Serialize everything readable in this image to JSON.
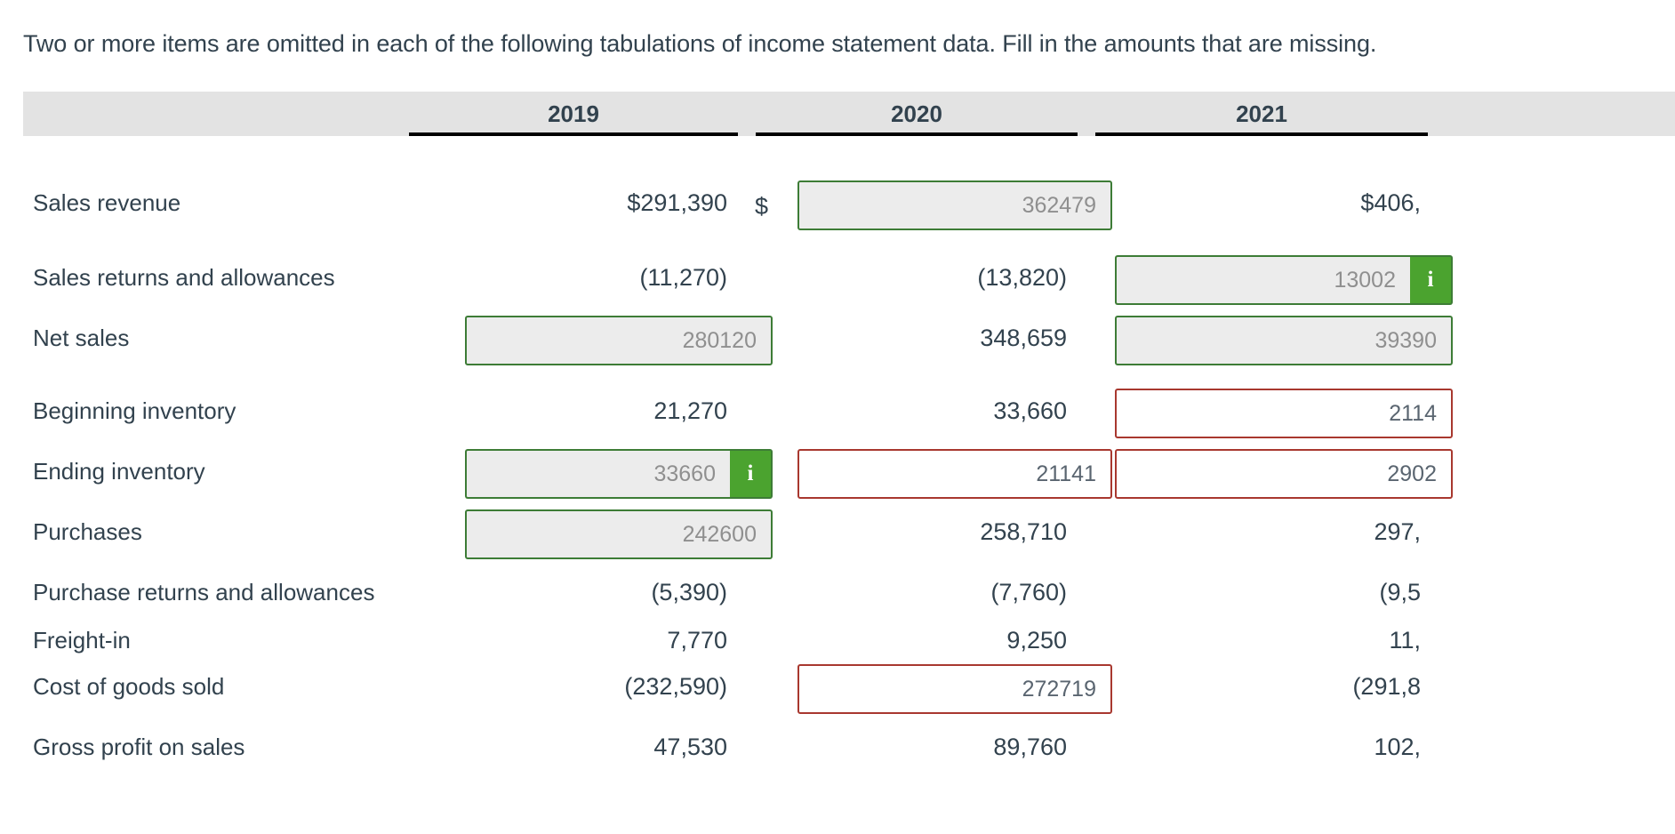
{
  "prompt": "Two or more items are omitted in each of the following tabulations of income statement data. Fill in the amounts that are missing.",
  "columns": [
    {
      "year": "2019"
    },
    {
      "year": "2020"
    },
    {
      "year": "2021"
    }
  ],
  "currency_symbol": "$",
  "info_badge_glyph": "i",
  "colors": {
    "header_bg": "#e3e3e3",
    "text": "#32424e",
    "input_correct_border": "#3d7c36",
    "input_correct_bg": "#ececec",
    "input_incorrect_border": "#a8382f",
    "badge_bg": "#4ba32f",
    "placeholder_text": "#8f8f8f"
  },
  "rows": [
    {
      "label": "Sales revenue",
      "cells": [
        {
          "type": "text",
          "value": "$291,390"
        },
        {
          "type": "input",
          "state": "correct",
          "value": "362479",
          "prefix": "$",
          "badge": false
        },
        {
          "type": "text",
          "value": "$406,"
        }
      ]
    },
    {
      "label": "Sales returns and allowances",
      "cells": [
        {
          "type": "text",
          "value": "(11,270)"
        },
        {
          "type": "text",
          "value": "(13,820)"
        },
        {
          "type": "input",
          "state": "correct",
          "value": "13002",
          "badge": true
        }
      ]
    },
    {
      "label": "Net sales",
      "cells": [
        {
          "type": "input",
          "state": "correct",
          "value": "280120",
          "badge": false
        },
        {
          "type": "text",
          "value": "348,659"
        },
        {
          "type": "input",
          "state": "correct",
          "value": "39390",
          "badge": false
        }
      ]
    },
    {
      "label": "Beginning inventory",
      "cells": [
        {
          "type": "text",
          "value": "21,270"
        },
        {
          "type": "text",
          "value": "33,660"
        },
        {
          "type": "input",
          "state": "incorrect",
          "value": "2114",
          "badge": false
        }
      ]
    },
    {
      "label": "Ending inventory",
      "cells": [
        {
          "type": "input",
          "state": "correct",
          "value": "33660",
          "badge": true
        },
        {
          "type": "input",
          "state": "incorrect",
          "value": "21141",
          "badge": false
        },
        {
          "type": "input",
          "state": "incorrect",
          "value": "2902",
          "badge": false
        }
      ]
    },
    {
      "label": "Purchases",
      "cells": [
        {
          "type": "input",
          "state": "correct",
          "value": "242600",
          "badge": false
        },
        {
          "type": "text",
          "value": "258,710"
        },
        {
          "type": "text",
          "value": "297,"
        }
      ]
    },
    {
      "label": "Purchase returns and allowances",
      "cells": [
        {
          "type": "text",
          "value": "(5,390)"
        },
        {
          "type": "text",
          "value": "(7,760)"
        },
        {
          "type": "text",
          "value": "(9,5"
        }
      ]
    },
    {
      "label": "Freight-in",
      "cells": [
        {
          "type": "text",
          "value": "7,770"
        },
        {
          "type": "text",
          "value": "9,250"
        },
        {
          "type": "text",
          "value": "11,"
        }
      ]
    },
    {
      "label": "Cost of goods sold",
      "cells": [
        {
          "type": "text",
          "value": "(232,590)"
        },
        {
          "type": "input",
          "state": "incorrect",
          "value": "272719",
          "badge": false
        },
        {
          "type": "text",
          "value": "(291,8"
        }
      ]
    },
    {
      "label": "Gross profit on sales",
      "cells": [
        {
          "type": "text",
          "value": "47,530"
        },
        {
          "type": "text",
          "value": "89,760"
        },
        {
          "type": "text",
          "value": "102,"
        }
      ]
    }
  ]
}
